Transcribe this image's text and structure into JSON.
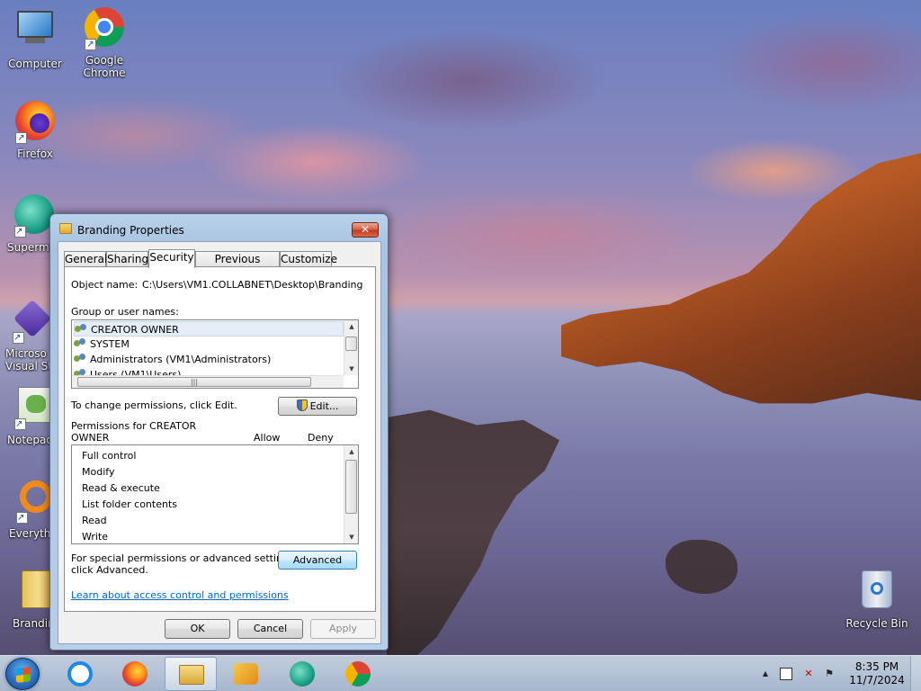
{
  "desktop": {
    "icons": [
      {
        "label": "Computer",
        "icon": "computer-icon"
      },
      {
        "label": "Google\nChrome",
        "icon": "chrome-icon"
      },
      {
        "label": "Firefox",
        "icon": "firefox-icon"
      },
      {
        "label": "Supermi",
        "icon": "supermium-icon"
      },
      {
        "label": "Microso\nVisual Stu",
        "icon": "visual-studio-icon"
      },
      {
        "label": "Notepad",
        "icon": "notepad-icon"
      },
      {
        "label": "Everythi",
        "icon": "everything-icon"
      },
      {
        "label": "Brandin",
        "icon": "folder-icon"
      },
      {
        "label": "Recycle Bin",
        "icon": "recycle-bin-icon"
      }
    ]
  },
  "dialog": {
    "title": "Branding Properties",
    "close_glyph": "✕",
    "tabs": [
      "General",
      "Sharing",
      "Security",
      "Previous Versions",
      "Customize"
    ],
    "active_tab": "Security",
    "object_name_label": "Object name:",
    "object_name_value": "C:\\Users\\VM1.COLLABNET\\Desktop\\Branding",
    "group_label": "Group or user names:",
    "groups": [
      "CREATOR OWNER",
      "SYSTEM",
      "Administrators (VM1\\Administrators)",
      "Users (VM1\\Users)"
    ],
    "selected_group": "CREATOR OWNER",
    "change_text": "To change permissions, click Edit.",
    "edit_button": "Edit...",
    "permissions_for_line1": "Permissions for CREATOR",
    "permissions_for_line2": "OWNER",
    "allow_header": "Allow",
    "deny_header": "Deny",
    "permissions": [
      "Full control",
      "Modify",
      "Read & execute",
      "List folder contents",
      "Read",
      "Write"
    ],
    "special_line1": "For special permissions or advanced settings,",
    "special_line2": "click Advanced.",
    "advanced_button": "Advanced",
    "learn_link": "Learn about access control and permissions",
    "ok_button": "OK",
    "cancel_button": "Cancel",
    "apply_button": "Apply"
  },
  "taskbar": {
    "apps": [
      "internet-explorer-icon",
      "firefox-icon",
      "file-explorer-icon",
      "media-player-icon",
      "supermium-icon",
      "chrome-icon"
    ],
    "active_app": "file-explorer-icon",
    "tray_up_glyph": "▲",
    "time": "8:35 PM",
    "date": "11/7/2024"
  },
  "colors": {
    "accent": "#3c7fb1",
    "link": "#0066cc",
    "close_red": "#c23a1f"
  }
}
